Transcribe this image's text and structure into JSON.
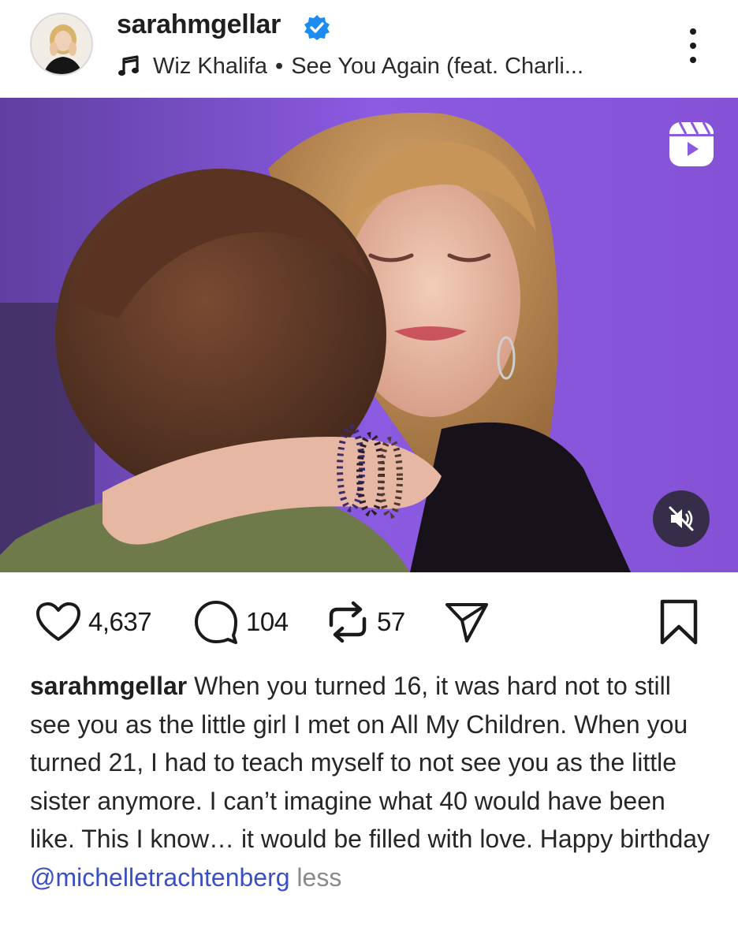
{
  "header": {
    "username": "sarahmgellar",
    "verified_icon": "verified-badge-icon",
    "music": {
      "icon": "music-note-icon",
      "artist": "Wiz Khalifa",
      "separator": "•",
      "track": "See You Again (feat. Charli..."
    },
    "more_icon": "more-vertical-icon"
  },
  "media": {
    "reels_icon": "reels-icon",
    "mute_icon": "muted-speaker-icon",
    "accent_color": "#8a5ae0"
  },
  "actions": {
    "likes": "4,637",
    "comments": "104",
    "reposts": "57",
    "like_icon": "heart-icon",
    "comment_icon": "comment-bubble-icon",
    "repost_icon": "repost-icon",
    "share_icon": "send-icon",
    "save_icon": "bookmark-icon"
  },
  "caption": {
    "username": "sarahmgellar",
    "text": " When you turned 16, it was hard not to still see you as the little girl I met on All My Children. When you turned 21, I had to teach myself to not see you as the little sister anymore. I can’t imagine what 40 would have been like. This I know… it would be filled with love. Happy birthday ",
    "mention_symbol": "@",
    "mention": "michelletrachtenberg",
    "less_label": " less",
    "mention_color": "#3b4fc4"
  }
}
